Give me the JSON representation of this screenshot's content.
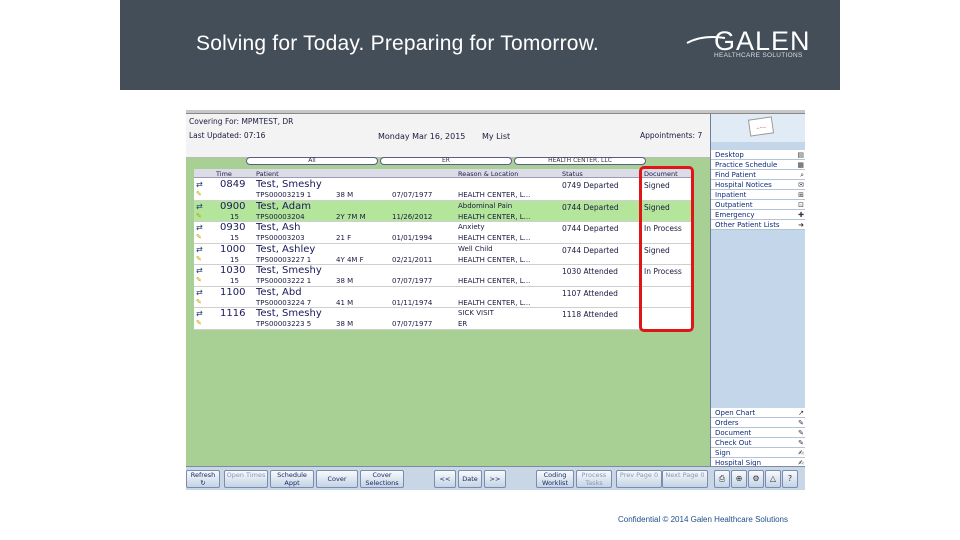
{
  "banner": {
    "title": "Solving for Today. Preparing for Tomorrow.",
    "logo_word": "GALEN",
    "logo_sub": "HEALTHCARE SOLUTIONS"
  },
  "header": {
    "covering": "Covering For: MPMTEST, DR",
    "last_updated": "Last Updated: 07:16",
    "date": "Monday Mar 16, 2015",
    "list": "My List",
    "appointments": "Appointments: 7"
  },
  "filters": [
    "All",
    "ER",
    "HEALTH CENTER, LLC"
  ],
  "columns": [
    "Time",
    "Patient",
    "Reason & Location",
    "Status",
    "Document"
  ],
  "rows": [
    {
      "time": "0849",
      "rank": "",
      "name": "Test, Smeshy",
      "acct": "TPS00003219 1",
      "age": "38 M",
      "dob": "07/07/1977",
      "reason": "",
      "loc": "HEALTH CENTER, L...",
      "status": "0749 Departed",
      "doc": "Signed",
      "highlight": false
    },
    {
      "time": "0900",
      "rank": "15",
      "name": "Test, Adam",
      "acct": "TPS00003204",
      "age": "2Y 7M M",
      "dob": "11/26/2012",
      "reason": "Abdominal Pain",
      "loc": "HEALTH CENTER, L...",
      "status": "0744 Departed",
      "doc": "Signed",
      "highlight": true
    },
    {
      "time": "0930",
      "rank": "15",
      "name": "Test, Ash",
      "acct": "TPS00003203",
      "age": "21 F",
      "dob": "01/01/1994",
      "reason": "Anxiety",
      "loc": "HEALTH CENTER, L...",
      "status": "0744 Departed",
      "doc": "In Process",
      "highlight": false
    },
    {
      "time": "1000",
      "rank": "15",
      "name": "Test, Ashley",
      "acct": "TPS00003227 1",
      "age": "4Y 4M F",
      "dob": "02/21/2011",
      "reason": "Well Child",
      "loc": "HEALTH CENTER, L...",
      "status": "0744 Departed",
      "doc": "Signed",
      "highlight": false
    },
    {
      "time": "1030",
      "rank": "15",
      "name": "Test, Smeshy",
      "acct": "TPS00003222 1",
      "age": "38 M",
      "dob": "07/07/1977",
      "reason": "",
      "loc": "HEALTH CENTER, L...",
      "status": "1030 Attended",
      "doc": "In Process",
      "highlight": false
    },
    {
      "time": "1100",
      "rank": "",
      "name": "Test, Abd",
      "acct": "TPS00003224 7",
      "age": "41 M",
      "dob": "01/11/1974",
      "reason": "",
      "loc": "HEALTH CENTER, L...",
      "status": "1107 Attended",
      "doc": "",
      "highlight": false
    },
    {
      "time": "1116",
      "rank": "",
      "name": "Test, Smeshy",
      "acct": "TPS00003223 5",
      "age": "38 M",
      "dob": "07/07/1977",
      "reason": "SICK VISIT",
      "loc": "ER",
      "status": "1118 Attended",
      "doc": "",
      "highlight": false
    }
  ],
  "sidebar": {
    "top_items": [
      {
        "label": "Desktop",
        "icon": "desktop-icon",
        "glyph": "▤"
      },
      {
        "label": "Practice Schedule",
        "icon": "calendar-icon",
        "glyph": "▦"
      },
      {
        "label": "Find Patient",
        "icon": "search-icon",
        "glyph": "⌕"
      },
      {
        "label": "Hospital Notices",
        "icon": "notice-icon",
        "glyph": "✉"
      },
      {
        "label": "Inpatient",
        "icon": "bed-icon",
        "glyph": "⊞"
      },
      {
        "label": "Outpatient",
        "icon": "walk-icon",
        "glyph": "⊡"
      },
      {
        "label": "Emergency",
        "icon": "emergency-icon",
        "glyph": "✚"
      },
      {
        "label": "Other Patient Lists",
        "icon": "arrow-icon",
        "glyph": "➜"
      }
    ],
    "bottom_items": [
      {
        "label": "Open Chart",
        "icon": "chart-icon",
        "glyph": "↗"
      },
      {
        "label": "Orders",
        "icon": "orders-icon",
        "glyph": "✎"
      },
      {
        "label": "Document",
        "icon": "document-icon",
        "glyph": "✎"
      },
      {
        "label": "Check Out",
        "icon": "checkout-icon",
        "glyph": "✎"
      },
      {
        "label": "Sign",
        "icon": "sign-icon",
        "glyph": "✍"
      },
      {
        "label": "Hospital Sign",
        "icon": "hospital-sign-icon",
        "glyph": "✍"
      }
    ]
  },
  "buttons": {
    "refresh": "Refresh",
    "open_times": "Open Times",
    "schedule_appt": "Schedule Appt",
    "cover": "Cover",
    "cover_selections": "Cover Selections",
    "prev": "<<",
    "date": "Date",
    "next": ">>",
    "coding_worklist": "Coding Worklist",
    "process_tasks": "Process Tasks",
    "prev_page": "Prev Page 0",
    "next_page": "Next Page 0"
  },
  "footer": "Confidential © 2014 Galen Healthcare Solutions",
  "colors": {
    "banner": "#434e59",
    "screen": "#a8d095",
    "highlight_row": "#b3e69a",
    "callout": "#e01515"
  }
}
